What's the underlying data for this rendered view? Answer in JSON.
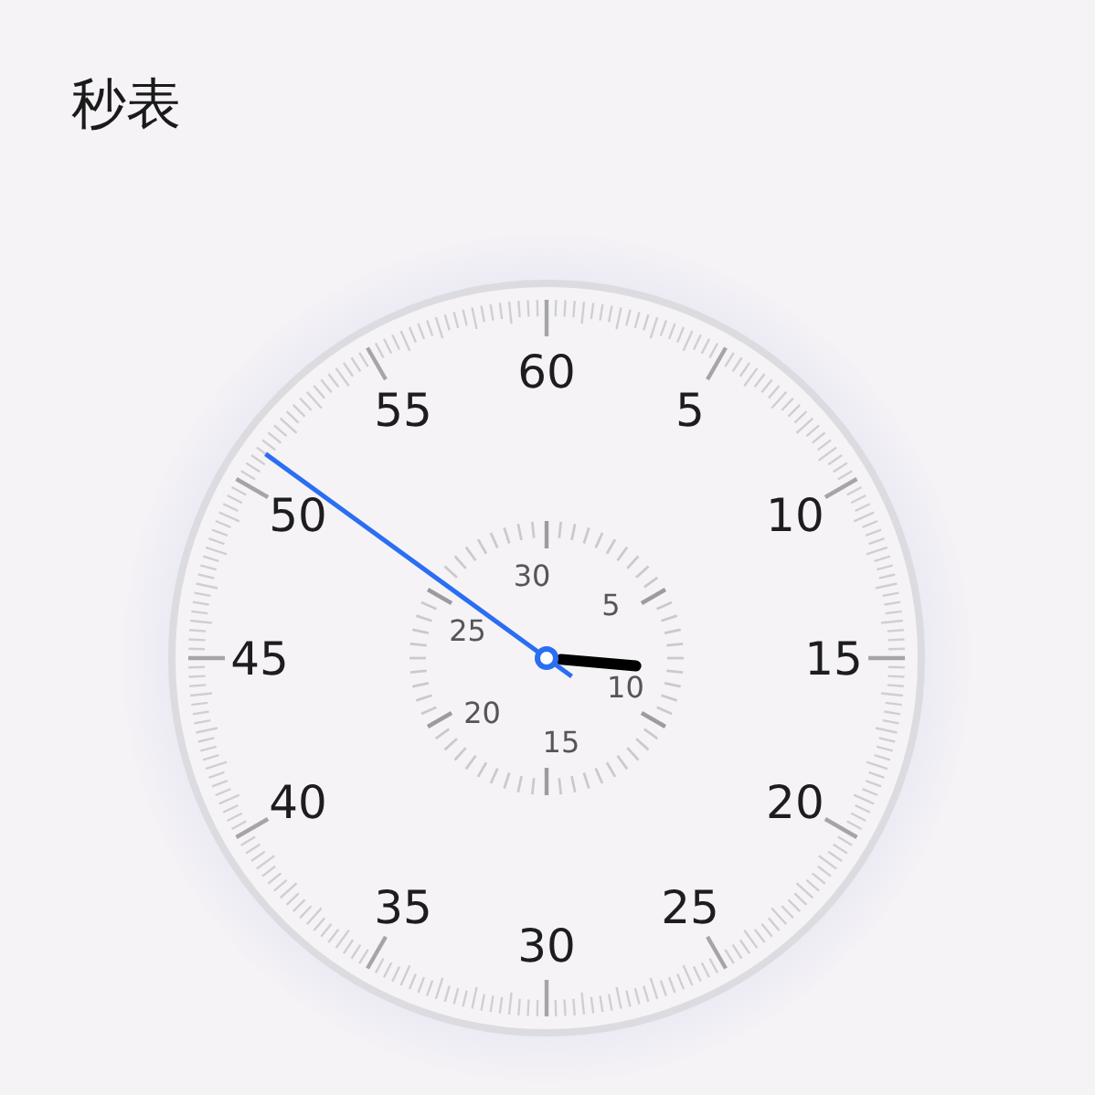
{
  "title": "秒表",
  "dial": {
    "labels": [
      "60",
      "5",
      "10",
      "15",
      "20",
      "25",
      "30",
      "35",
      "40",
      "45",
      "50",
      "55"
    ],
    "subdial": {
      "labels": [
        "30",
        "5",
        "10",
        "15",
        "20",
        "25"
      ]
    }
  }
}
